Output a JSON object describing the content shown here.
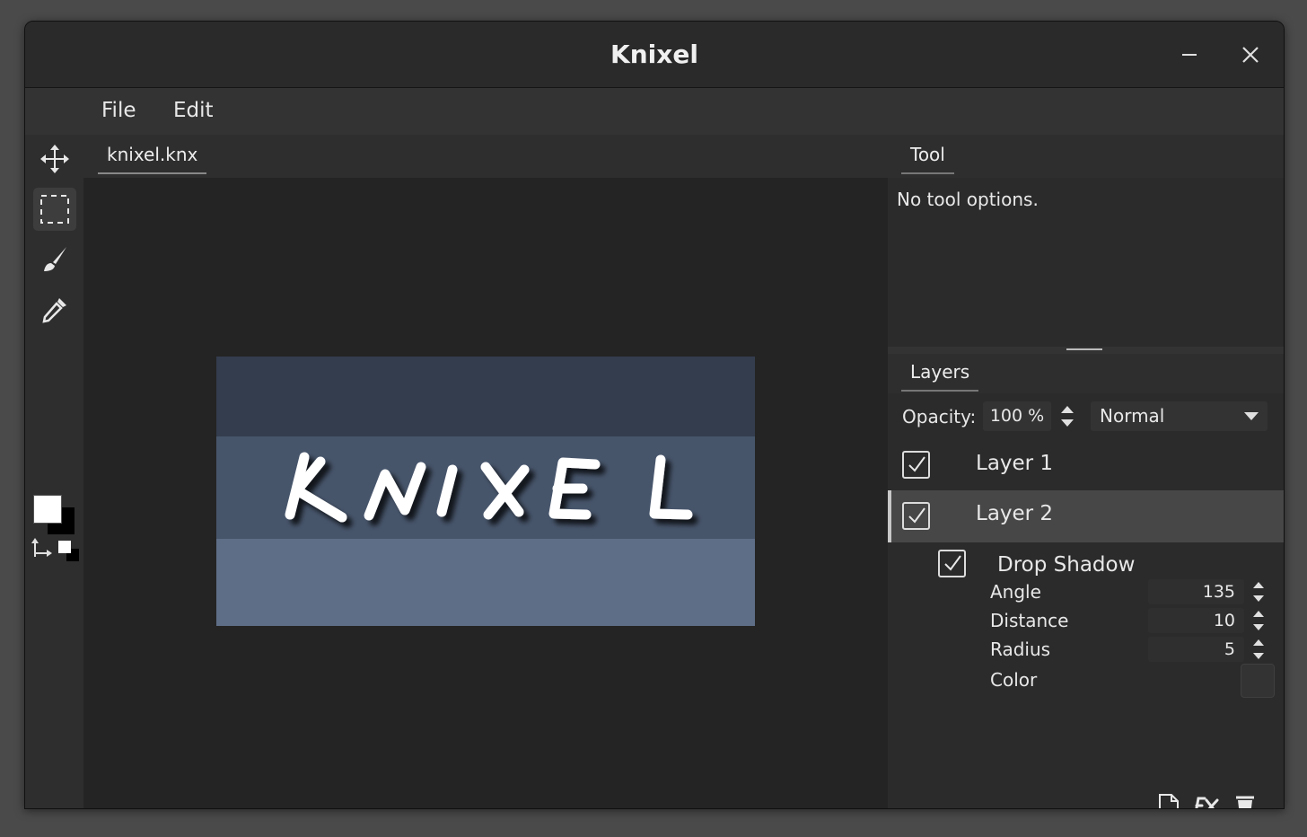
{
  "window": {
    "title": "Knixel"
  },
  "menu": {
    "file": "File",
    "edit": "Edit"
  },
  "tools": [
    {
      "name": "move-tool",
      "icon": "move-arrows-icon"
    },
    {
      "name": "rect-select-tool",
      "icon": "dashed-rectangle-icon",
      "active": true
    },
    {
      "name": "brush-tool",
      "icon": "paintbrush-icon"
    },
    {
      "name": "eyedropper-tool",
      "icon": "eyedropper-icon"
    }
  ],
  "colors": {
    "foreground": "#ffffff",
    "background": "#000000"
  },
  "document": {
    "tab_label": "knixel.knx",
    "canvas_text": "KNIXEL",
    "bands": [
      "#333d4e",
      "#47556b",
      "#5e6e87"
    ]
  },
  "tool_panel": {
    "tab_label": "Tool",
    "message": "No tool options."
  },
  "layers_panel": {
    "tab_label": "Layers",
    "opacity_label": "Opacity:",
    "opacity_value": "100 %",
    "blend_mode": "Normal",
    "layers": [
      {
        "name": "Layer 1",
        "visible": true,
        "selected": false
      },
      {
        "name": "Layer 2",
        "visible": true,
        "selected": true
      }
    ],
    "effect": {
      "name": "Drop Shadow",
      "enabled": true,
      "angle_label": "Angle",
      "angle": "135",
      "distance_label": "Distance",
      "distance": "10",
      "radius_label": "Radius",
      "radius": "5",
      "color_label": "Color"
    },
    "footer_icons": [
      "new-layer-icon",
      "fx-icon",
      "trash-icon"
    ]
  }
}
